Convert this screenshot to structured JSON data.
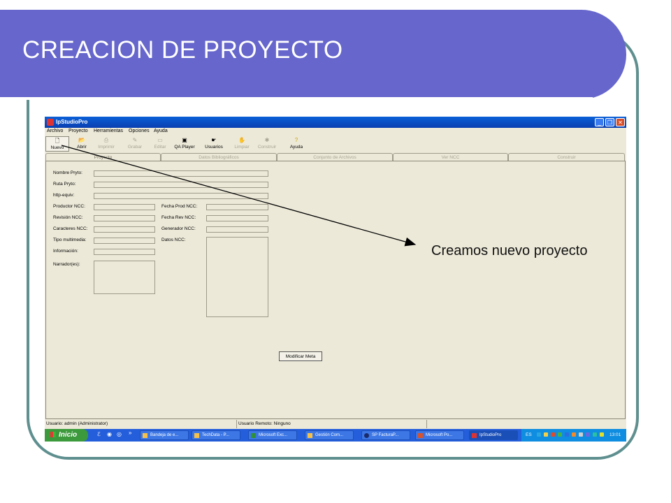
{
  "slide": {
    "title": "CREACION  DE PROYECTO",
    "callout": "Creamos nuevo proyecto"
  },
  "window": {
    "title": "IpStudioPro",
    "buttons": [
      "_",
      "❐",
      "✕"
    ]
  },
  "menu": [
    "Archivo",
    "Proyecto",
    "Herramientas",
    "Opciones",
    "Ayuda"
  ],
  "toolbar": [
    {
      "label": "Nuevo",
      "icon": "new-file-icon",
      "glyph": "🗋",
      "enabled": true
    },
    {
      "label": "Abrir",
      "icon": "folder-open-icon",
      "glyph": "📂",
      "enabled": true
    },
    {
      "label": "Imprimir",
      "icon": "printer-icon",
      "glyph": "⎙",
      "enabled": false
    },
    {
      "label": "Grabar",
      "icon": "record-icon",
      "glyph": "✎",
      "enabled": false
    },
    {
      "label": "Editar",
      "icon": "edit-icon",
      "glyph": "▭",
      "enabled": false
    },
    {
      "label": "QA Player",
      "icon": "qa-player-icon",
      "glyph": "▣",
      "enabled": true
    },
    {
      "label": "Usuarios",
      "icon": "users-icon",
      "glyph": "☛",
      "enabled": true
    },
    {
      "label": "Limpiar",
      "icon": "clean-icon",
      "glyph": "✋",
      "enabled": false
    },
    {
      "label": "Construir",
      "icon": "build-icon",
      "glyph": "✱",
      "enabled": false
    },
    {
      "label": "Ayuda",
      "icon": "help-icon",
      "glyph": "?",
      "enabled": true
    }
  ],
  "tabs": [
    "Proyecto",
    "Datos Bibliográficos",
    "Conjunto de Archivos",
    "Ver NCC",
    "Construir"
  ],
  "form": {
    "nombre_label": "Nombre Pryto:",
    "ruta_label": "Ruta Pryto:",
    "http_label": "http-equiv:",
    "productor_label": "Productor NCC:",
    "revision_label": "Revisión NCC:",
    "caracteres_label": "Caracteres NCC:",
    "tipo_label": "Tipo multimedia:",
    "informacion_label": "Información:",
    "narrador_label": "Narrador(es):",
    "fecha_prod_label": "Fecha Prod NCC:",
    "fecha_rev_label": "Fecha Rev NCC:",
    "generador_label": "Generador NCC:",
    "datos_label": "Datos NCC:",
    "modificar_button": "Modificar Meta"
  },
  "status": {
    "user": "Usuario: admin (Administrator)",
    "remote": "Usuario Remoto: Ninguno"
  },
  "taskbar": {
    "start": "Inicio",
    "quicklaunch_more": "»",
    "tasks": [
      "Bandeja de e...",
      "TechData - P...",
      "Microsoft Exc...",
      "Gestión Com...",
      "SP FacturaP...",
      "Microsoft Po...",
      "IpStudioPro"
    ],
    "lang": "ES",
    "clock": "13:01"
  },
  "colors": {
    "banner": "#6666cc",
    "frame": "#5f8f8f",
    "window_bg": "#ece9d8",
    "titlebar": "#0a4fc8",
    "taskbar": "#245edb",
    "start": "#3c9a3c"
  }
}
